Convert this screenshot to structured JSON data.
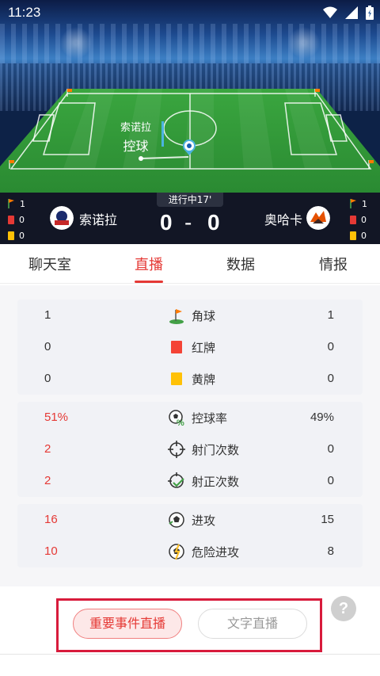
{
  "status_bar": {
    "time": "11:23"
  },
  "pitch": {
    "possession_team": "索诺拉",
    "possession_status": "控球"
  },
  "match": {
    "status": "进行中17'",
    "home": {
      "name": "索诺拉",
      "score": "0",
      "corners": "1",
      "red_cards": "0",
      "yellow_cards": "0"
    },
    "away": {
      "name": "奥哈卡",
      "score": "0",
      "corners": "1",
      "red_cards": "0",
      "yellow_cards": "0"
    },
    "score_separator": "-"
  },
  "tabs": [
    {
      "label": "聊天室",
      "active": false
    },
    {
      "label": "直播",
      "active": true
    },
    {
      "label": "数据",
      "active": false
    },
    {
      "label": "情报",
      "active": false
    }
  ],
  "stats": {
    "group1": [
      {
        "label": "角球",
        "home": "1",
        "away": "1",
        "icon": "corner-flag-icon"
      },
      {
        "label": "红牌",
        "home": "0",
        "away": "0",
        "icon": "red-card-icon"
      },
      {
        "label": "黄牌",
        "home": "0",
        "away": "0",
        "icon": "yellow-card-icon"
      }
    ],
    "group2": [
      {
        "label": "控球率",
        "home": "51%",
        "away": "49%",
        "icon": "possession-icon"
      },
      {
        "label": "射门次数",
        "home": "2",
        "away": "0",
        "icon": "target-icon"
      },
      {
        "label": "射正次数",
        "home": "2",
        "away": "0",
        "icon": "target-check-icon"
      }
    ],
    "group3": [
      {
        "label": "进攻",
        "home": "16",
        "away": "15",
        "icon": "attack-ball-icon"
      },
      {
        "label": "危险进攻",
        "home": "10",
        "away": "8",
        "icon": "danger-attack-icon"
      }
    ]
  },
  "bottom": {
    "primary_button": "重要事件直播",
    "secondary_button": "文字直播",
    "help": "?"
  },
  "colors": {
    "accent": "#e53935",
    "pitch": "#2e9a3a",
    "scoreboard": "#12161f"
  }
}
